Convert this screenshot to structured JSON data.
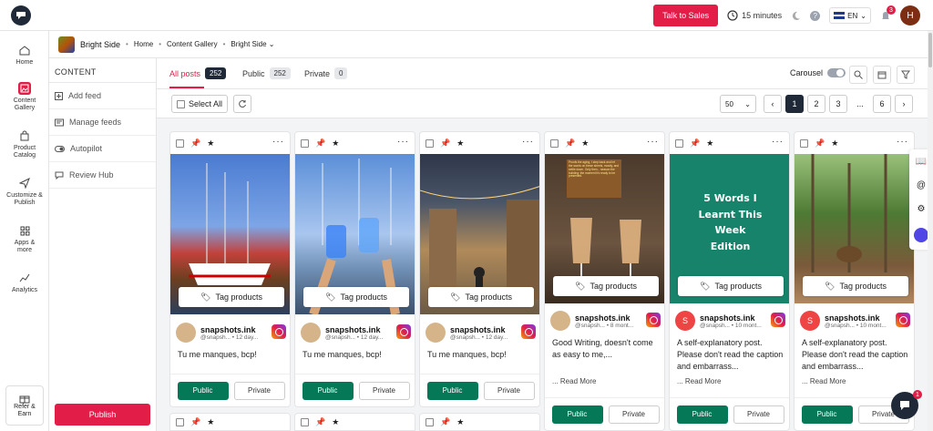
{
  "topbar": {
    "talk_btn": "Talk to Sales",
    "timer": "15 minutes",
    "lang": "EN",
    "notif_count": "3",
    "avatar": "H"
  },
  "sidebar": {
    "items": [
      {
        "label": "Home",
        "icon": "home-icon"
      },
      {
        "label": "Content Gallery",
        "icon": "gallery-icon"
      },
      {
        "label": "Product Catalog",
        "icon": "bag-icon"
      },
      {
        "label": "Customize & Publish",
        "icon": "send-icon"
      },
      {
        "label": "Apps & more",
        "icon": "apps-icon"
      },
      {
        "label": "Analytics",
        "icon": "chart-icon"
      }
    ],
    "refer": "Refer & Earn"
  },
  "breadcrumb": {
    "brand": "Bright Side",
    "home": "Home",
    "gallery": "Content Gallery",
    "current": "Bright Side"
  },
  "subnav": {
    "heading": "CONTENT",
    "items": [
      "Add feed",
      "Manage feeds",
      "Autopilot",
      "Review Hub"
    ],
    "publish": "Publish"
  },
  "tabs": [
    {
      "label": "All posts",
      "count": "252"
    },
    {
      "label": "Public",
      "count": "252"
    },
    {
      "label": "Private",
      "count": "0"
    }
  ],
  "carousel_label": "Carousel",
  "toolbar": {
    "select_all": "Select All",
    "per_page": "50",
    "pages": [
      "1",
      "2",
      "3",
      "...",
      "6"
    ]
  },
  "cards": [
    {
      "author": "snapshots.ink",
      "handle": "@snapsh... • 12 day...",
      "caption": "Tu me manques, bcp!",
      "read_more": "",
      "tag": "Tag products",
      "public": "Public",
      "private": "Private"
    },
    {
      "author": "snapshots.ink",
      "handle": "@snapsh... • 12 day...",
      "caption": "Tu me manques, bcp!",
      "read_more": "",
      "tag": "Tag products",
      "public": "Public",
      "private": "Private"
    },
    {
      "author": "snapshots.ink",
      "handle": "@snapsh... • 12 day...",
      "caption": "Tu me manques, bcp!",
      "read_more": "",
      "tag": "Tag products",
      "public": "Public",
      "private": "Private"
    },
    {
      "author": "snapshots.ink",
      "handle": "@snapsh... • 8 mont...",
      "caption": "Good Writing, doesn't come as easy to me,...",
      "read_more": "... Read More",
      "tag": "Tag products",
      "public": "Public",
      "private": "Private",
      "image_text": "Proofs the aging, I step back and let the words on these sheets, mostly, and settle down. Only then... season the building; the moment it's ready to be presented."
    },
    {
      "author": "snapshots.ink",
      "handle": "@snapsh... • 10 mont...",
      "caption": "A self-explanatory post. Please don't read the caption and embarrass...",
      "read_more": "... Read More",
      "tag": "Tag products",
      "public": "Public",
      "private": "Private",
      "image_text": "5 Words I Learnt This Week Edition",
      "avatar_letter": "S"
    },
    {
      "author": "snapshots.ink",
      "handle": "@snapsh... • 10 mont...",
      "caption": "A self-explanatory post. Please don't read the caption and embarrass...",
      "read_more": "... Read More",
      "tag": "Tag products",
      "public": "Public",
      "private": "Private",
      "avatar_letter": "S"
    }
  ],
  "chat_badge": "1"
}
